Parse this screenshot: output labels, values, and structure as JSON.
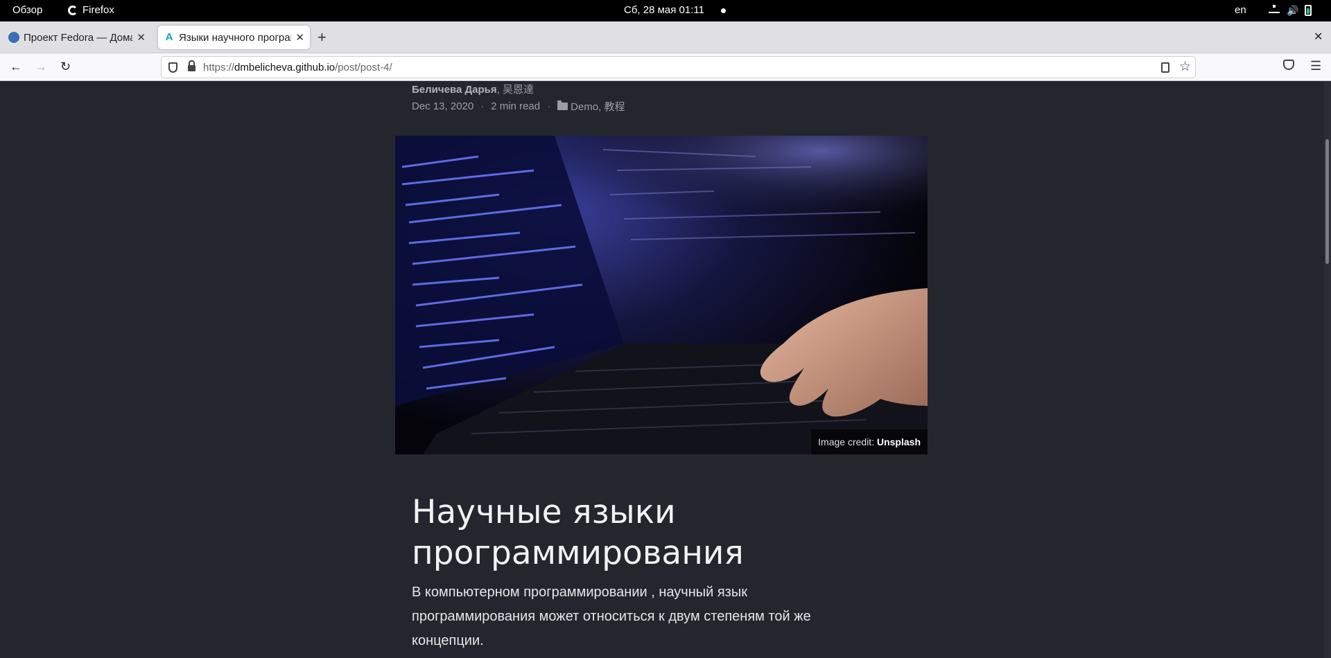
{
  "system_bar": {
    "activities": "Обзор",
    "app_name": "Firefox",
    "clock": "Сб, 28 мая  01:11",
    "language": "en"
  },
  "tabs": [
    {
      "title": "Проект Fedora — Домашняя",
      "active": false
    },
    {
      "title": "Языки научного программирования",
      "active": true
    }
  ],
  "address_bar": {
    "url_prefix": "https://",
    "url_host": "dmbelicheva.github.io",
    "url_path": "/post/post-4/"
  },
  "article": {
    "author_primary": "Беличева Дарья",
    "author_secondary": ", 吴恩達",
    "date": "Dec 13, 2020",
    "separator": "·",
    "read_time": "2 min read",
    "categories": "Demo, 教程",
    "image_credit_label": "Image credit: ",
    "image_credit_source": "Unsplash",
    "title": "Научные языки программирования",
    "lead": "В компьютерном программировании , научный язык программирования может относиться к двум степеням той же концепции."
  },
  "colors": {
    "page_background": "#24262e",
    "system_bar": "#000000",
    "tab_strip": "#e0e0e3",
    "accent_tab_icon": "#17a2b8"
  },
  "icons": [
    "firefox-icon",
    "network-icon",
    "volume-icon",
    "battery-icon",
    "fedora-favicon",
    "academic-favicon",
    "close-icon",
    "new-tab-icon",
    "back-arrow-icon",
    "forward-arrow-icon",
    "reload-icon",
    "shield-icon",
    "lock-icon",
    "reader-view-icon",
    "bookmark-star-icon",
    "pocket-icon",
    "hamburger-menu-icon",
    "folder-icon"
  ]
}
